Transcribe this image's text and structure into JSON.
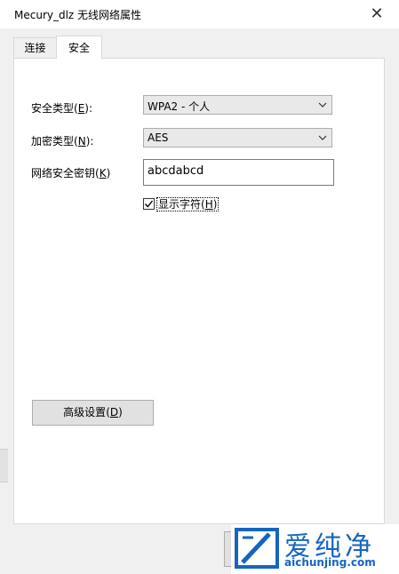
{
  "window": {
    "title": "Mecury_dlz 无线网络属性",
    "close_glyph": "✕"
  },
  "tabs": [
    {
      "label": "连接",
      "active": false
    },
    {
      "label": "安全",
      "active": true
    }
  ],
  "security": {
    "security_type": {
      "label": "安全类型",
      "key": "E",
      "value": "WPA2 - 个人"
    },
    "encryption_type": {
      "label": "加密类型",
      "key": "N",
      "value": "AES"
    },
    "network_key": {
      "label": "网络安全密钥",
      "key": "K",
      "value": "abcdabcd"
    },
    "show_chars": {
      "label": "显示字符",
      "key": "H",
      "checked": true
    }
  },
  "advanced_button": {
    "label": "高级设置",
    "key": "D"
  },
  "watermark": {
    "cn_text": "爱纯净",
    "url": "aichunjing.com",
    "color": "#1565c0"
  }
}
